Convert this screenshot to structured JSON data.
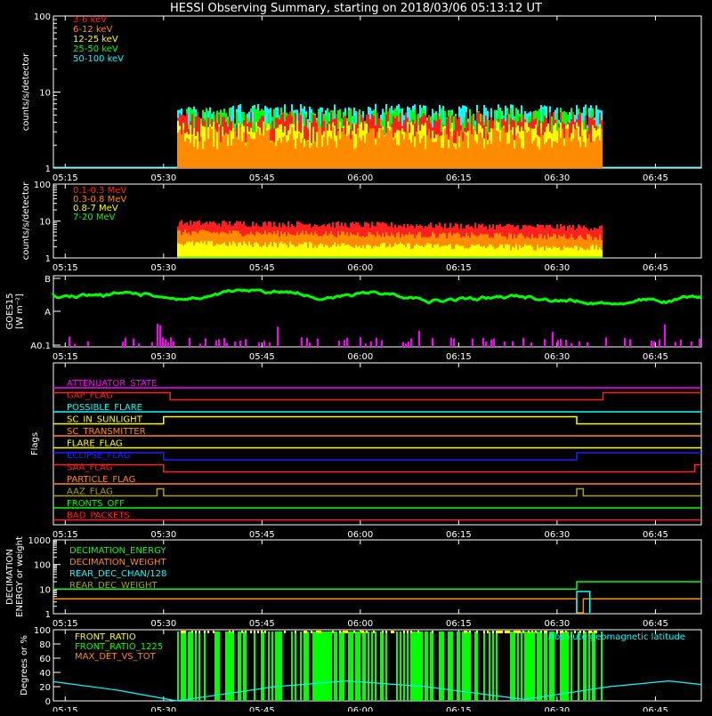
{
  "title": "HESSI Observing Summary, starting on 2018/03/06 05:13:12 UT",
  "time_ticks": [
    "05:15",
    "05:30",
    "05:45",
    "06:00",
    "06:15",
    "06:30",
    "06:45"
  ],
  "colors": {
    "red": "#ff2020",
    "orange": "#ff8c00",
    "yellow": "#ffff00",
    "green": "#00ff00",
    "cyan": "#00ffff",
    "magenta": "#ff00ff",
    "blue": "#2020ff",
    "white": "#ffffff",
    "olive": "#b0a000"
  },
  "chart_data": [
    {
      "type": "bar",
      "id": "hxr",
      "ylabel": "counts/s/detector",
      "yscale": "log",
      "ylim": [
        1,
        100
      ],
      "yticks": [
        "1",
        "10",
        "100"
      ],
      "series": [
        {
          "name": "3-6 keV",
          "color": "#ff2020"
        },
        {
          "name": "6-12 keV",
          "color": "#ff8c00"
        },
        {
          "name": "12-25 keV",
          "color": "#ffff00"
        },
        {
          "name": "25-50 keV",
          "color": "#00ff00"
        },
        {
          "name": "50-100 keV",
          "color": "#00ffff"
        }
      ],
      "data_interval": [
        "05:32",
        "06:37"
      ],
      "typical_levels": {
        "3-6 keV": 4,
        "6-12 keV": 2.5,
        "12-25 keV": 3,
        "25-50 keV": 4.5,
        "50-100 keV": 5
      }
    },
    {
      "type": "line",
      "id": "gamma",
      "ylabel": "counts/s/detector",
      "yscale": "log",
      "ylim": [
        1,
        100
      ],
      "yticks": [
        "1",
        "10",
        "100"
      ],
      "series": [
        {
          "name": "0.1-0.3 MeV",
          "color": "#ff2020"
        },
        {
          "name": "0.3-0.8 MeV",
          "color": "#ff8c00"
        },
        {
          "name": "0.8-7 MeV",
          "color": "#ffff00"
        },
        {
          "name": "7-20 MeV",
          "color": "#00ff00"
        }
      ],
      "data_interval": [
        "05:32",
        "06:37"
      ],
      "typical_levels": {
        "0.1-0.3 MeV": 9,
        "0.3-0.8 MeV": 5,
        "0.8-7 MeV": 2.5,
        "7-20 MeV": 1
      }
    },
    {
      "type": "line",
      "id": "goes",
      "ylabel": "GOES15",
      "ylabel2": "[W m⁻²]",
      "yticks": [
        "A0.1",
        "A",
        "B"
      ],
      "series": [
        {
          "color": "#00ff00",
          "level": "A-B"
        },
        {
          "color": "#ff00ff",
          "level": "A0.1"
        }
      ]
    },
    {
      "type": "line",
      "id": "flags",
      "ylabel": "Flags",
      "flags": [
        {
          "name": "ATTENUATOR_STATE",
          "color": "#ff00ff",
          "segments": [
            [
              0,
              0
            ]
          ],
          "default": 0
        },
        {
          "name": "GAP_FLAG",
          "color": "#ff2020",
          "high_intervals": [
            [
              "05:13",
              "05:31"
            ],
            [
              "06:37",
              "06:52"
            ]
          ]
        },
        {
          "name": "POSSIBLE_FLARE",
          "color": "#00ffff",
          "high_intervals": []
        },
        {
          "name": "SC_IN_SUNLIGHT",
          "color": "#ffff00",
          "high_intervals": [
            [
              "05:30",
              "06:33"
            ]
          ]
        },
        {
          "name": "SC_TRANSMITTER",
          "color": "#ff8c00",
          "high_intervals": []
        },
        {
          "name": "FLARE_FLAG",
          "color": "#ffff00",
          "high_intervals": []
        },
        {
          "name": "ECLIPSE_FLAG",
          "color": "#2020ff",
          "high_intervals": [
            [
              "05:13",
              "05:30"
            ],
            [
              "06:33",
              "06:52"
            ]
          ]
        },
        {
          "name": "SAA_FLAG",
          "color": "#ff2020",
          "high_intervals": [
            [
              "05:13",
              "05:30"
            ],
            [
              "06:51",
              "06:52"
            ]
          ]
        },
        {
          "name": "PARTICLE_FLAG",
          "color": "#ff8c00",
          "high_intervals": []
        },
        {
          "name": "AAZ_FLAG",
          "color": "#b0a000",
          "high_intervals": [
            [
              "05:29",
              "05:30"
            ],
            [
              "06:33",
              "06:34"
            ]
          ]
        },
        {
          "name": "FRONTS_OFF",
          "color": "#00ff00",
          "high_intervals": []
        },
        {
          "name": "BAD_PACKETS",
          "color": "#ff2020",
          "high_intervals": []
        }
      ]
    },
    {
      "type": "line",
      "id": "decimation",
      "ylabel": "DECIMATION",
      "ylabel2": "ENERGY or weight",
      "yscale": "log",
      "ylim": [
        1,
        1000
      ],
      "yticks": [
        "1",
        "10",
        "100",
        "1000"
      ],
      "series": [
        {
          "name": "DECIMATION_ENERGY",
          "color": "#00ff00",
          "steps": [
            [
              "05:13",
              10
            ],
            [
              "06:33",
              10
            ],
            [
              "06:33",
              20
            ],
            [
              "06:52",
              20
            ]
          ]
        },
        {
          "name": "DECIMATION_WEIGHT",
          "color": "#ff8c00",
          "steps": [
            [
              "05:13",
              4
            ],
            [
              "06:33",
              4
            ],
            [
              "06:33",
              1
            ],
            [
              "06:34",
              1
            ],
            [
              "06:34",
              4
            ],
            [
              "06:52",
              4
            ]
          ]
        },
        {
          "name": "REAR_DEC_CHAN/128",
          "color": "#00ffff",
          "steps": [
            [
              "06:33",
              1
            ],
            [
              "06:33",
              8
            ],
            [
              "06:35",
              8
            ],
            [
              "06:35",
              1
            ]
          ]
        },
        {
          "name": "REAR_DEC_WEIGHT",
          "color": "#b0a000",
          "steps": []
        }
      ]
    },
    {
      "type": "line",
      "id": "ratio",
      "ylabel": "Degrees or %",
      "ylim": [
        0,
        100
      ],
      "yticks": [
        "0",
        "20",
        "40",
        "60",
        "80",
        "100"
      ],
      "series": [
        {
          "name": "FRONT_RATIO",
          "color": "#ffff00"
        },
        {
          "name": "FRONT_RATIO_1225",
          "color": "#00ff00"
        },
        {
          "name": "MAX_DET_VS_TOT",
          "color": "#ff8c00"
        }
      ],
      "extra_label": "Absolute geomagnetic latitude",
      "extra_color": "#00ffff",
      "latitude_points": [
        [
          "05:13",
          27
        ],
        [
          "05:23",
          15
        ],
        [
          "05:32",
          0
        ],
        [
          "05:47",
          20
        ],
        [
          "05:58",
          28
        ],
        [
          "06:10",
          20
        ],
        [
          "06:25",
          2
        ],
        [
          "06:38",
          20
        ],
        [
          "06:47",
          28
        ],
        [
          "06:52",
          23
        ]
      ]
    }
  ]
}
